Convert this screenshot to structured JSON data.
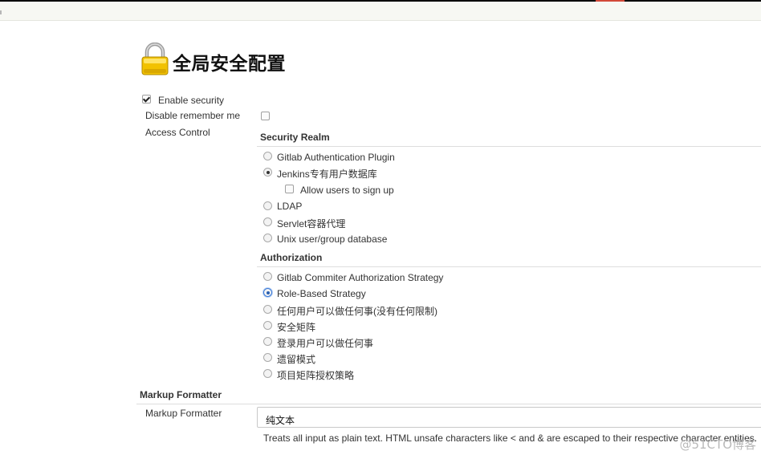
{
  "page": {
    "title": "全局安全配置",
    "icon": "lock-icon"
  },
  "security": {
    "enable_security_label": "Enable security",
    "enable_security_checked": true,
    "disable_remember_me_label": "Disable remember me",
    "disable_remember_me_checked": false,
    "access_control_label": "Access Control"
  },
  "security_realm": {
    "heading": "Security Realm",
    "options": [
      {
        "label": "Gitlab Authentication Plugin",
        "selected": false
      },
      {
        "label": "Jenkins专有用户数据库",
        "selected": true
      },
      {
        "label": "LDAP",
        "selected": false
      },
      {
        "label": "Servlet容器代理",
        "selected": false
      },
      {
        "label": "Unix user/group database",
        "selected": false
      }
    ],
    "allow_signup_label": "Allow users to sign up",
    "allow_signup_checked": false
  },
  "authorization": {
    "heading": "Authorization",
    "options": [
      {
        "label": "Gitlab Commiter Authorization Strategy",
        "selected": false
      },
      {
        "label": "Role-Based Strategy",
        "selected": true
      },
      {
        "label": "任何用户可以做任何事(没有任何限制)",
        "selected": false
      },
      {
        "label": "安全矩阵",
        "selected": false
      },
      {
        "label": "登录用户可以做任何事",
        "selected": false
      },
      {
        "label": "遗留模式",
        "selected": false
      },
      {
        "label": "项目矩阵授权策略",
        "selected": false
      }
    ]
  },
  "markup_formatter": {
    "section_heading": "Markup Formatter",
    "field_label": "Markup Formatter",
    "selected_value": "纯文本",
    "description": "Treats all input as plain text. HTML unsafe characters like < and & are escaped to their respective character entities."
  },
  "watermark": "@51CTO博客",
  "colors": {
    "top_bar": "#000000",
    "top_accent": "#d24939",
    "lock_body": "#f2c200",
    "focus_ring": "#3a79d6"
  }
}
